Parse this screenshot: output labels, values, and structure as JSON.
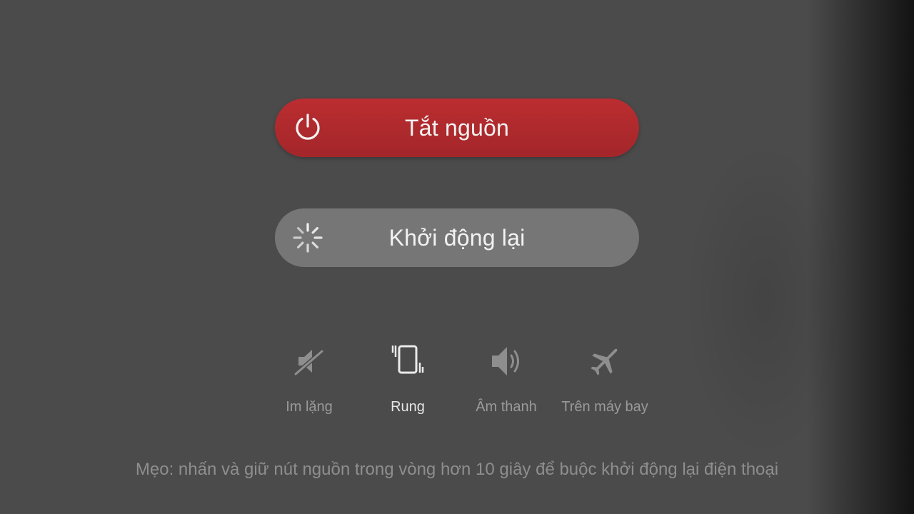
{
  "power_menu": {
    "power_off": {
      "label": "Tắt nguồn",
      "icon": "power-icon",
      "color": "#b02a2d"
    },
    "restart": {
      "label": "Khởi động lại",
      "icon": "restart-spinner-icon",
      "color": "#767676"
    }
  },
  "sound_modes": [
    {
      "label": "Im lặng",
      "icon": "mute-icon",
      "active": false
    },
    {
      "label": "Rung",
      "icon": "vibrate-icon",
      "active": true
    },
    {
      "label": "Âm thanh",
      "icon": "speaker-icon",
      "active": false
    },
    {
      "label": "Trên máy bay",
      "icon": "airplane-icon",
      "active": false
    }
  ],
  "tip": "Mẹo: nhấn và giữ nút nguồn trong vòng hơn 10 giây để buộc khởi động lại điện thoại"
}
